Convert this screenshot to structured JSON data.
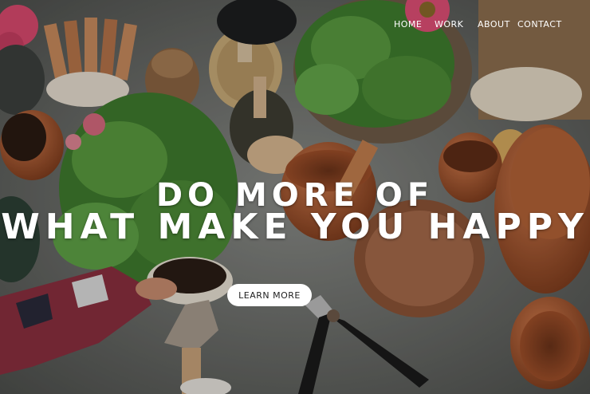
{
  "nav": {
    "items": [
      {
        "label": "HOME"
      },
      {
        "label": "WORK"
      },
      {
        "label": "ABOUT"
      },
      {
        "label": "CONTACT"
      }
    ]
  },
  "hero": {
    "headline_line1": "DO MORE OF",
    "headline_line2": "WHAT MAKE YOU HAPPY",
    "cta_label": "LEARN MORE"
  },
  "colors": {
    "concrete": "#6f716e",
    "terracotta": "#b8643c",
    "leaf_green": "#4f8a3a",
    "flower_pink": "#e0577a",
    "twine": "#c9ab78",
    "text": "#ffffff"
  }
}
